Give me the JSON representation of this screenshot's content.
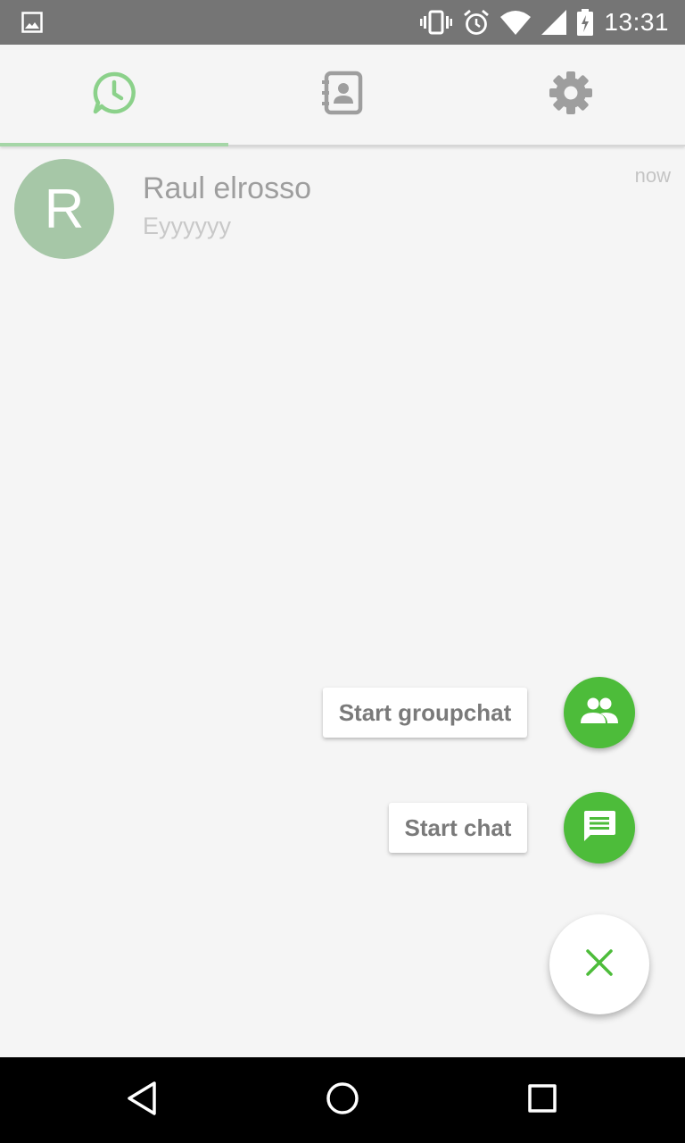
{
  "status_bar": {
    "time": "13:31",
    "icons": [
      "image-notification-icon",
      "vibrate-icon",
      "alarm-icon",
      "wifi-icon",
      "signal-icon",
      "battery-charging-icon"
    ]
  },
  "tabs": [
    {
      "icon": "clock-chat-icon",
      "active": true,
      "color": "#8bd18a"
    },
    {
      "icon": "contacts-book-icon",
      "active": false,
      "color": "#9e9e9e"
    },
    {
      "icon": "gear-icon",
      "active": false,
      "color": "#9e9e9e"
    }
  ],
  "chats": [
    {
      "avatar_letter": "R",
      "name": "Raul elrosso",
      "last_message": "Eyyyyyy",
      "time": "now"
    }
  ],
  "fab_menu": {
    "group_label": "Start groupchat",
    "chat_label": "Start chat",
    "accent_color": "#4dbc3a"
  },
  "nav_bar": {
    "buttons": [
      "back-icon",
      "home-icon",
      "recents-icon"
    ]
  }
}
